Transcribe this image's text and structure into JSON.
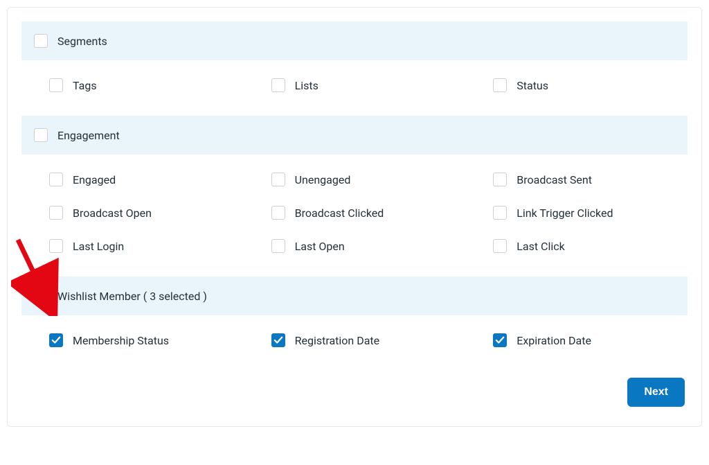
{
  "sections": {
    "segments": {
      "label": "Segments",
      "checked": false,
      "items": {
        "tags": {
          "label": "Tags",
          "checked": false
        },
        "lists": {
          "label": "Lists",
          "checked": false
        },
        "status": {
          "label": "Status",
          "checked": false
        }
      }
    },
    "engagement": {
      "label": "Engagement",
      "checked": false,
      "items": {
        "engaged": {
          "label": "Engaged",
          "checked": false
        },
        "unengaged": {
          "label": "Unengaged",
          "checked": false
        },
        "broadcast_sent": {
          "label": "Broadcast Sent",
          "checked": false
        },
        "broadcast_open": {
          "label": "Broadcast Open",
          "checked": false
        },
        "broadcast_clicked": {
          "label": "Broadcast Clicked",
          "checked": false
        },
        "link_trigger_clicked": {
          "label": "Link Trigger Clicked",
          "checked": false
        },
        "last_login": {
          "label": "Last Login",
          "checked": false
        },
        "last_open": {
          "label": "Last Open",
          "checked": false
        },
        "last_click": {
          "label": "Last Click",
          "checked": false
        }
      }
    },
    "wishlist": {
      "label": "Wishlist Member ( 3 selected )",
      "checked": true,
      "items": {
        "membership_status": {
          "label": "Membership Status",
          "checked": true
        },
        "registration_date": {
          "label": "Registration Date",
          "checked": true
        },
        "expiration_date": {
          "label": "Expiration Date",
          "checked": true
        }
      }
    }
  },
  "actions": {
    "next_label": "Next"
  }
}
